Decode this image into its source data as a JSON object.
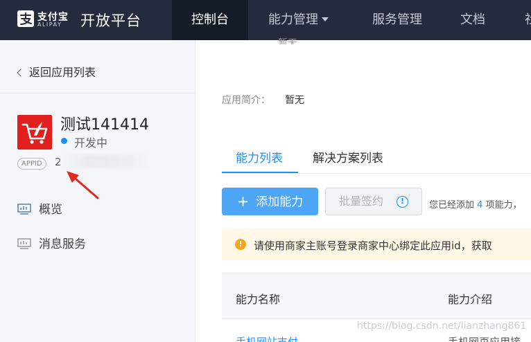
{
  "header": {
    "logo_cn": "支付宝",
    "logo_en": "ALIPAY",
    "platform_title": "开放平台",
    "nav": [
      {
        "label": "控制台"
      },
      {
        "label": "能力管理"
      },
      {
        "label": "服务管理"
      },
      {
        "label": "文档"
      },
      {
        "label": "社"
      }
    ]
  },
  "sidebar": {
    "back_label": "返回应用列表",
    "app": {
      "name": "测试141414",
      "status": "开发中",
      "appid_badge": "APPID",
      "appid_value": "2"
    },
    "menu": [
      {
        "label": "概览",
        "icon": "dashboard-icon"
      },
      {
        "label": "消息服务",
        "icon": "monitor-icon"
      }
    ]
  },
  "main": {
    "cut_row_value": "暂无",
    "description_label": "应用简介：",
    "description_value": "暂无",
    "tabs": [
      {
        "label": "能力列表"
      },
      {
        "label": "解决方案列表"
      }
    ],
    "add_button": "添加能力",
    "batch_button": "批量签约",
    "added_note_prefix": "您已经添加",
    "added_count": "4",
    "added_note_suffix": "项能力，",
    "notice_text": "请使用商家主账号登录商家中心绑定此应用id，获取",
    "table": {
      "columns": [
        "能力名称",
        "能力介绍"
      ],
      "rows": [
        {
          "name": "手机网站支付",
          "intro": "手机网页应用接"
        }
      ]
    },
    "watermark": "https://blog.csdn.net/lianzhang861"
  },
  "colors": {
    "topbar": "#252b3d",
    "accent": "#1890ff",
    "app_icon": "#e0201f",
    "notice_bg": "#fff8e6",
    "warning": "#f5a623"
  }
}
